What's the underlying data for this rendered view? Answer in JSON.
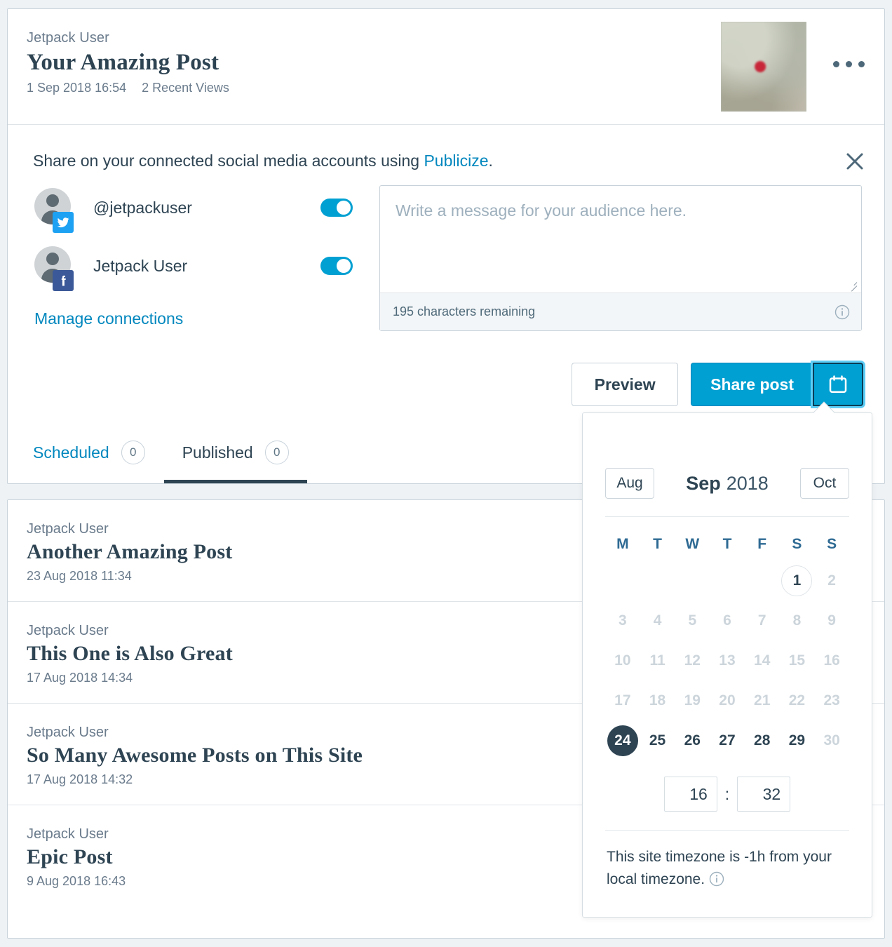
{
  "post": {
    "author": "Jetpack User",
    "title": "Your Amazing Post",
    "date": "1 Sep 2018 16:54",
    "views": "2 Recent Views",
    "thumbnail_alt": "post-thumbnail",
    "more_icon": "ellipsis-icon"
  },
  "publicize": {
    "share_text_before": "Share on your connected social media accounts using ",
    "link_label": "Publicize",
    "share_text_after": ".",
    "close_icon": "close-icon",
    "connections": [
      {
        "name": "@jetpackuser",
        "service": "twitter",
        "enabled": true
      },
      {
        "name": "Jetpack User",
        "service": "facebook",
        "enabled": true
      }
    ],
    "manage_label": "Manage connections",
    "message": {
      "value": "",
      "placeholder": "Write a message for your audience here.",
      "char_count": "195 characters remaining",
      "info_icon": "info-icon"
    },
    "preview_label": "Preview",
    "share_label": "Share post",
    "calendar_icon": "calendar-icon"
  },
  "tabs": [
    {
      "label": "Scheduled",
      "count": "0",
      "active": false
    },
    {
      "label": "Published",
      "count": "0",
      "active": true
    }
  ],
  "posts": [
    {
      "author": "Jetpack User",
      "title": "Another Amazing Post",
      "date": "23 Aug 2018 11:34"
    },
    {
      "author": "Jetpack User",
      "title": "This One is Also Great",
      "date": "17 Aug 2018 14:34"
    },
    {
      "author": "Jetpack User",
      "title": "So Many Awesome Posts on This Site",
      "date": "17 Aug 2018 14:32"
    },
    {
      "author": "Jetpack User",
      "title": "Epic Post",
      "date": "9 Aug 2018 16:43"
    }
  ],
  "calendar": {
    "prev_month": "Aug",
    "month": "Sep",
    "year": "2018",
    "next_month": "Oct",
    "weekdays": [
      "M",
      "T",
      "W",
      "T",
      "F",
      "S",
      "S"
    ],
    "weeks": [
      [
        {
          "d": "",
          "state": "empty"
        },
        {
          "d": "",
          "state": "empty"
        },
        {
          "d": "",
          "state": "empty"
        },
        {
          "d": "",
          "state": "empty"
        },
        {
          "d": "",
          "state": "empty"
        },
        {
          "d": "1",
          "state": "today"
        },
        {
          "d": "2",
          "state": "disabled"
        }
      ],
      [
        {
          "d": "3",
          "state": "disabled"
        },
        {
          "d": "4",
          "state": "disabled"
        },
        {
          "d": "5",
          "state": "disabled"
        },
        {
          "d": "6",
          "state": "disabled"
        },
        {
          "d": "7",
          "state": "disabled"
        },
        {
          "d": "8",
          "state": "disabled"
        },
        {
          "d": "9",
          "state": "disabled"
        }
      ],
      [
        {
          "d": "10",
          "state": "disabled"
        },
        {
          "d": "11",
          "state": "disabled"
        },
        {
          "d": "12",
          "state": "disabled"
        },
        {
          "d": "13",
          "state": "disabled"
        },
        {
          "d": "14",
          "state": "disabled"
        },
        {
          "d": "15",
          "state": "disabled"
        },
        {
          "d": "16",
          "state": "disabled"
        }
      ],
      [
        {
          "d": "17",
          "state": "disabled"
        },
        {
          "d": "18",
          "state": "disabled"
        },
        {
          "d": "19",
          "state": "disabled"
        },
        {
          "d": "20",
          "state": "disabled"
        },
        {
          "d": "21",
          "state": "disabled"
        },
        {
          "d": "22",
          "state": "disabled"
        },
        {
          "d": "23",
          "state": "disabled"
        }
      ],
      [
        {
          "d": "24",
          "state": "selected"
        },
        {
          "d": "25",
          "state": "normal"
        },
        {
          "d": "26",
          "state": "normal"
        },
        {
          "d": "27",
          "state": "normal"
        },
        {
          "d": "28",
          "state": "normal"
        },
        {
          "d": "29",
          "state": "normal"
        },
        {
          "d": "30",
          "state": "disabled"
        }
      ]
    ],
    "hour": "16",
    "minute": "32",
    "time_separator": ":",
    "timezone_note": "This site timezone is -1h from your local timezone.",
    "timezone_info_icon": "info-icon"
  },
  "colors": {
    "accent": "#00a0d2",
    "link": "#0087be",
    "dark": "#2e4453",
    "muted": "#6a7b8c",
    "border": "#c8d2da",
    "page_bg": "#eef2f5"
  }
}
